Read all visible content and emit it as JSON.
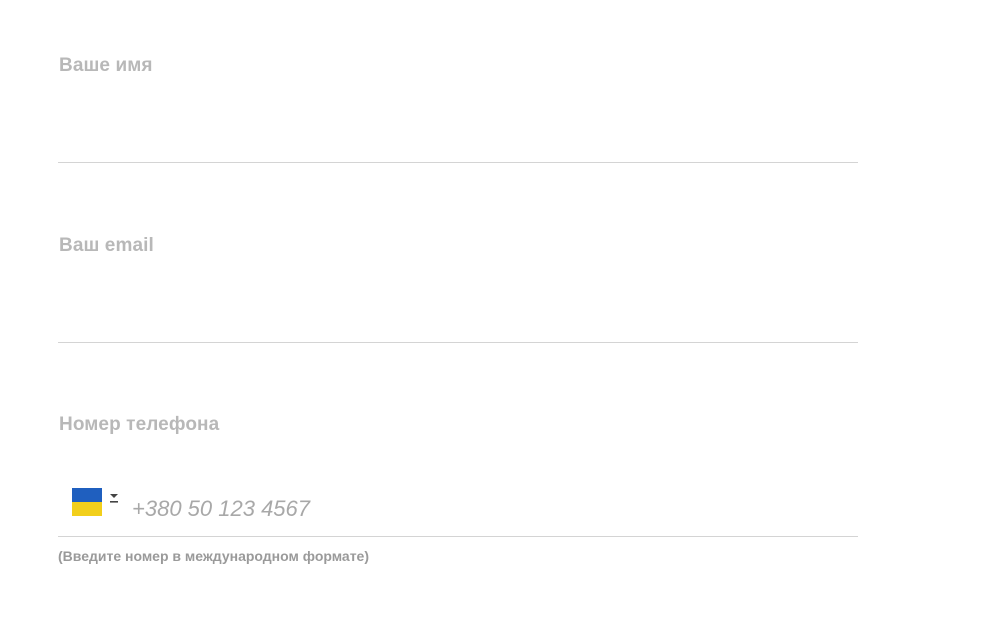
{
  "form": {
    "name": {
      "label": "Ваше имя",
      "value": ""
    },
    "email": {
      "label": "Ваш email",
      "value": ""
    },
    "phone": {
      "label": "Номер телефона",
      "placeholder": "+380 50 123 4567",
      "country_flag": "ukraine-flag-icon",
      "flag_colors": [
        "#1f5fbf",
        "#f2cf1b"
      ],
      "hint": "(Введите номер в международном формате)"
    }
  }
}
